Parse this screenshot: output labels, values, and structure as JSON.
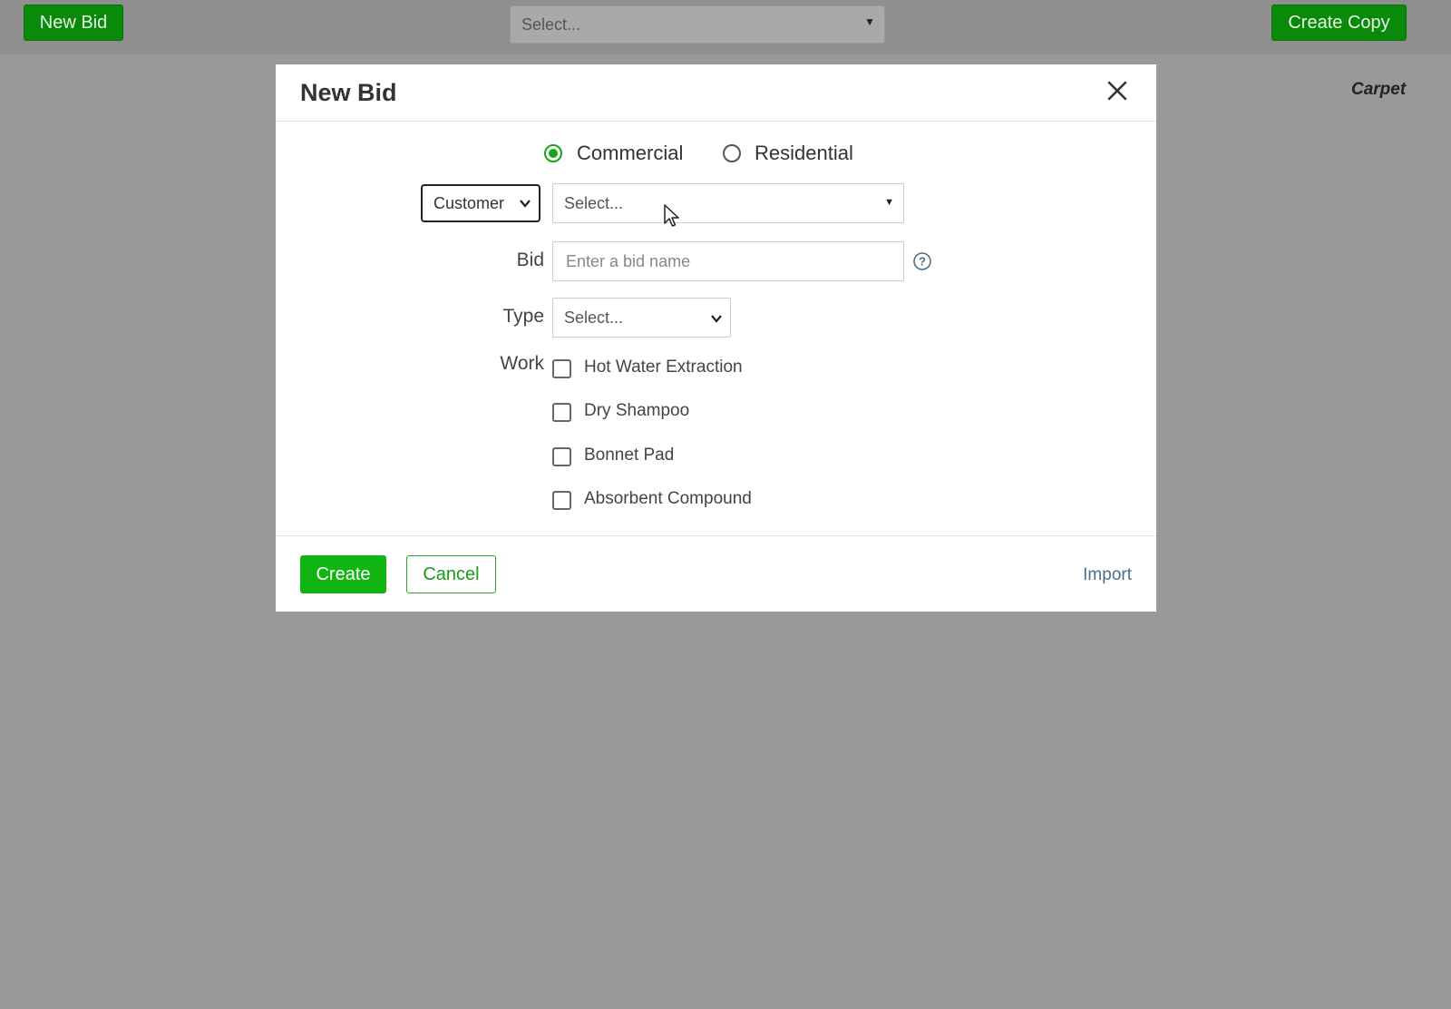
{
  "topbar": {
    "new_bid_label": "New Bid",
    "select_placeholder": "Select...",
    "create_copy_label": "Create Copy"
  },
  "background": {
    "carpet_label": "Carpet"
  },
  "modal": {
    "title": "New Bid",
    "client_types": [
      {
        "label": "Commercial",
        "selected": true
      },
      {
        "label": "Residential",
        "selected": false
      }
    ],
    "customer_dropdown": {
      "value": "Customer"
    },
    "customer_select": {
      "placeholder": "Select..."
    },
    "bid": {
      "label": "Bid",
      "placeholder": "Enter a bid name"
    },
    "type": {
      "label": "Type",
      "value": "Select..."
    },
    "work": {
      "label": "Work",
      "options": [
        {
          "label": "Hot Water Extraction",
          "checked": false
        },
        {
          "label": "Dry Shampoo",
          "checked": false
        },
        {
          "label": "Bonnet Pad",
          "checked": false
        },
        {
          "label": "Absorbent Compound",
          "checked": false
        }
      ]
    },
    "footer": {
      "create_label": "Create",
      "cancel_label": "Cancel",
      "import_label": "Import"
    }
  },
  "colors": {
    "primary_green": "#11b511",
    "overlay_gray": "#999999"
  }
}
